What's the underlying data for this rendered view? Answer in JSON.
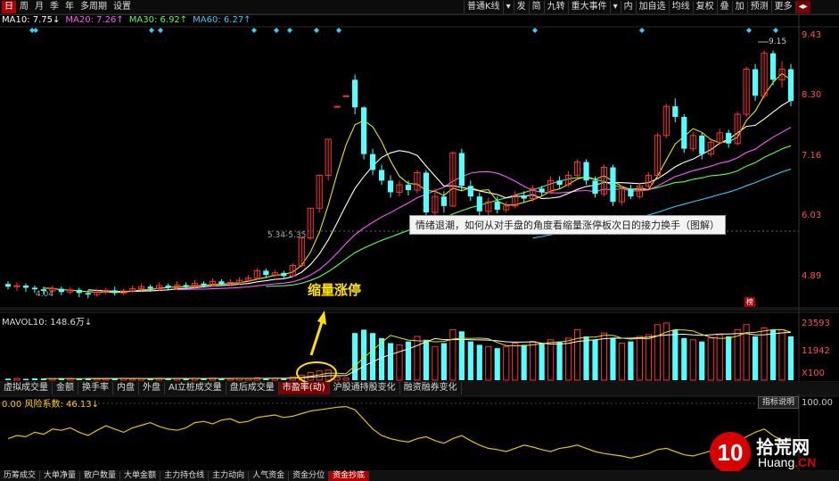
{
  "toolbar": {
    "left": [
      "日",
      "周",
      "月",
      "季",
      "年",
      "多周期",
      "设置"
    ],
    "right": [
      "普通K线",
      "▾",
      "发",
      "简",
      "九转",
      "重大事件",
      "▾",
      "内",
      "加自选",
      "均线",
      "复权",
      "叠",
      "加",
      "预测",
      "更多",
      "◂▸"
    ]
  },
  "ma_legend": [
    {
      "label": "MA10: 7.75↓",
      "color": "#ffffff"
    },
    {
      "label": "MA20: 7.26↑",
      "color": "#ff55ff"
    },
    {
      "label": "MA30: 6.92↑",
      "color": "#55ff55"
    },
    {
      "label": "MA60: 6.27↑",
      "color": "#33ccff"
    }
  ],
  "price_axis": [
    "9.43",
    "8.30",
    "7.16",
    "6.03",
    "4.89"
  ],
  "volume_label": "MAVOL10: 148.6万↓",
  "volume_axis": [
    "23593",
    "11942",
    "X100"
  ],
  "risk_label": "0.00 风险系数: 46.13↓",
  "risk_axis": [
    "100.00",
    "0.00"
  ],
  "price_tags": {
    "high": "9.15",
    "mid": "5.34-5.35",
    "low": "4.04"
  },
  "tooltip": "情绪退潮，如何从对手盘的角度看缩量涨停板次日的接力换手（图解）",
  "annotation": "缩量涨停",
  "indicator_button": "指标说明",
  "stat_button": "榜",
  "indicator_tabs": [
    "虚拟成交量",
    "金额",
    "换手率",
    "内盘",
    "外盘",
    "AI立桩成交量",
    "盘后成交量",
    "市盈率(动)",
    "沪股通持股变化",
    "融资融券变化"
  ],
  "bottom_tabs": [
    "历筹成交",
    "大单净量",
    "散户数量",
    "大单金额",
    "主力持仓线",
    "主力动向",
    "人气资金",
    "资金分位",
    "资金抄底"
  ],
  "logo": {
    "number": "10",
    "cn": "拾荒网",
    "en_left": "Huang",
    "en_right": ".CN"
  },
  "chart_data": {
    "type": "candlestick",
    "price_range": [
      4.3,
      9.6
    ],
    "candles": [
      [
        4.75,
        4.7,
        4.8,
        4.65
      ],
      [
        4.7,
        4.72,
        4.78,
        4.62
      ],
      [
        4.72,
        4.68,
        4.76,
        4.6
      ],
      [
        4.68,
        4.65,
        4.72,
        4.58
      ],
      [
        4.65,
        4.62,
        4.7,
        4.55
      ],
      [
        4.62,
        4.66,
        4.72,
        4.58
      ],
      [
        4.66,
        4.6,
        4.7,
        4.54
      ],
      [
        4.6,
        4.64,
        4.69,
        4.56
      ],
      [
        4.64,
        4.58,
        4.68,
        4.5
      ],
      [
        4.58,
        4.55,
        4.63,
        4.48
      ],
      [
        4.55,
        4.6,
        4.66,
        4.51
      ],
      [
        4.6,
        4.63,
        4.68,
        4.55
      ],
      [
        4.63,
        4.58,
        4.7,
        4.53
      ],
      [
        4.58,
        4.62,
        4.66,
        4.54
      ],
      [
        4.62,
        4.66,
        4.72,
        4.58
      ],
      [
        4.66,
        4.7,
        4.76,
        4.62
      ],
      [
        4.7,
        4.66,
        4.74,
        4.6
      ],
      [
        4.66,
        4.72,
        4.78,
        4.62
      ],
      [
        4.72,
        4.68,
        4.76,
        4.63
      ],
      [
        4.68,
        4.73,
        4.8,
        4.64
      ],
      [
        4.73,
        4.7,
        4.78,
        4.65
      ],
      [
        4.7,
        4.76,
        4.82,
        4.66
      ],
      [
        4.76,
        4.72,
        4.8,
        4.68
      ],
      [
        4.72,
        4.8,
        4.86,
        4.7
      ],
      [
        4.8,
        4.75,
        4.84,
        4.71
      ],
      [
        4.75,
        4.78,
        4.84,
        4.72
      ],
      [
        4.78,
        4.82,
        4.88,
        4.74
      ],
      [
        4.82,
        4.86,
        4.92,
        4.78
      ],
      [
        4.86,
        5.0,
        5.05,
        4.84
      ],
      [
        5.0,
        4.92,
        5.04,
        4.86
      ],
      [
        4.92,
        4.96,
        5.02,
        4.88
      ],
      [
        4.96,
        4.9,
        5.0,
        4.86
      ],
      [
        4.9,
        5.1,
        5.14,
        4.88
      ],
      [
        5.1,
        5.62,
        5.62,
        5.06
      ],
      [
        5.62,
        6.18,
        6.18,
        5.58
      ],
      [
        6.18,
        6.8,
        6.8,
        6.1
      ],
      [
        6.8,
        7.48,
        7.48,
        6.7
      ],
      [
        8.1,
        8.1,
        8.1,
        8.1
      ],
      [
        8.3,
        8.3,
        8.3,
        8.3
      ],
      [
        8.6,
        8.08,
        8.7,
        7.95
      ],
      [
        8.08,
        7.2,
        8.1,
        7.1
      ],
      [
        7.2,
        6.9,
        7.3,
        6.8
      ],
      [
        6.9,
        6.7,
        7.0,
        6.62
      ],
      [
        6.7,
        6.48,
        6.8,
        6.38
      ],
      [
        6.48,
        6.62,
        6.7,
        6.4
      ],
      [
        6.62,
        6.52,
        6.7,
        6.42
      ],
      [
        6.52,
        6.85,
        6.9,
        6.46
      ],
      [
        6.85,
        6.1,
        6.9,
        6.02
      ],
      [
        6.1,
        6.4,
        6.55,
        6.05
      ],
      [
        6.4,
        6.22,
        6.5,
        6.1
      ],
      [
        6.22,
        7.22,
        7.25,
        6.2
      ],
      [
        7.22,
        6.6,
        7.3,
        6.5
      ],
      [
        6.6,
        6.4,
        6.7,
        6.32
      ],
      [
        6.4,
        6.12,
        6.48,
        6.02
      ],
      [
        6.12,
        6.3,
        6.38,
        6.04
      ],
      [
        6.3,
        6.15,
        6.4,
        6.08
      ],
      [
        6.15,
        6.22,
        6.3,
        6.1
      ],
      [
        6.22,
        6.42,
        6.5,
        6.18
      ],
      [
        6.42,
        6.36,
        6.5,
        6.28
      ],
      [
        6.36,
        6.55,
        6.62,
        6.3
      ],
      [
        6.55,
        6.48,
        6.6,
        6.4
      ],
      [
        6.48,
        6.7,
        6.78,
        6.45
      ],
      [
        6.7,
        6.62,
        6.78,
        6.55
      ],
      [
        6.62,
        6.8,
        6.88,
        6.58
      ],
      [
        6.8,
        7.05,
        7.1,
        6.75
      ],
      [
        7.05,
        6.7,
        7.1,
        6.62
      ],
      [
        6.7,
        6.45,
        6.78,
        6.38
      ],
      [
        6.45,
        6.95,
        7.0,
        6.4
      ],
      [
        6.95,
        6.3,
        7.0,
        6.22
      ],
      [
        6.3,
        6.55,
        6.6,
        6.24
      ],
      [
        6.55,
        6.4,
        6.62,
        6.35
      ],
      [
        6.4,
        6.6,
        6.66,
        6.36
      ],
      [
        6.6,
        6.8,
        6.86,
        6.56
      ],
      [
        6.8,
        7.55,
        7.6,
        6.78
      ],
      [
        7.55,
        8.1,
        8.15,
        7.5
      ],
      [
        8.1,
        7.9,
        8.25,
        7.8
      ],
      [
        7.9,
        7.3,
        7.95,
        7.22
      ],
      [
        7.3,
        7.55,
        7.62,
        7.25
      ],
      [
        7.55,
        7.2,
        7.6,
        7.1
      ],
      [
        7.2,
        7.42,
        7.5,
        7.15
      ],
      [
        7.42,
        7.6,
        7.68,
        7.38
      ],
      [
        7.6,
        7.4,
        7.66,
        7.32
      ],
      [
        7.4,
        7.95,
        8.0,
        7.36
      ],
      [
        7.95,
        8.8,
        8.85,
        7.9
      ],
      [
        8.8,
        8.3,
        8.9,
        8.2
      ],
      [
        8.3,
        9.1,
        9.15,
        8.25
      ],
      [
        9.1,
        8.6,
        9.15,
        8.5
      ],
      [
        8.6,
        8.8,
        8.95,
        8.45
      ],
      [
        8.8,
        8.2,
        8.9,
        8.1
      ]
    ],
    "volumes": [
      9,
      10,
      8,
      11,
      10,
      9,
      12,
      8,
      10,
      11,
      9,
      10,
      12,
      11,
      9,
      10,
      8,
      11,
      12,
      10,
      9,
      11,
      10,
      12,
      10,
      9,
      11,
      10,
      14,
      12,
      11,
      10,
      20,
      30,
      45,
      55,
      60,
      18,
      12,
      280,
      300,
      280,
      250,
      220,
      210,
      230,
      260,
      240,
      200,
      220,
      300,
      290,
      230,
      210,
      200,
      190,
      200,
      220,
      210,
      230,
      220,
      240,
      230,
      250,
      300,
      260,
      240,
      280,
      250,
      220,
      230,
      260,
      270,
      330,
      340,
      300,
      250,
      240,
      230,
      250,
      270,
      260,
      300,
      330,
      260,
      310,
      300,
      300,
      260
    ],
    "volume_range": [
      0,
      350
    ],
    "risk_values": [
      45,
      50,
      48,
      55,
      52,
      60,
      58,
      62,
      55,
      50,
      58,
      65,
      60,
      55,
      62,
      66,
      70,
      64,
      60,
      58,
      62,
      70,
      72,
      68,
      74,
      76,
      70,
      72,
      78,
      80,
      82,
      78,
      80,
      84,
      88,
      90,
      92,
      94,
      95,
      90,
      75,
      60,
      50,
      45,
      42,
      40,
      45,
      48,
      42,
      38,
      45,
      50,
      42,
      35,
      30,
      28,
      25,
      30,
      35,
      32,
      28,
      25,
      30,
      32,
      35,
      30,
      25,
      22,
      20,
      18,
      15,
      18,
      22,
      28,
      30,
      25,
      20,
      18,
      22,
      26,
      30,
      35,
      40,
      48,
      55,
      60,
      50,
      42,
      46
    ],
    "risk_range": [
      0,
      100
    ]
  }
}
